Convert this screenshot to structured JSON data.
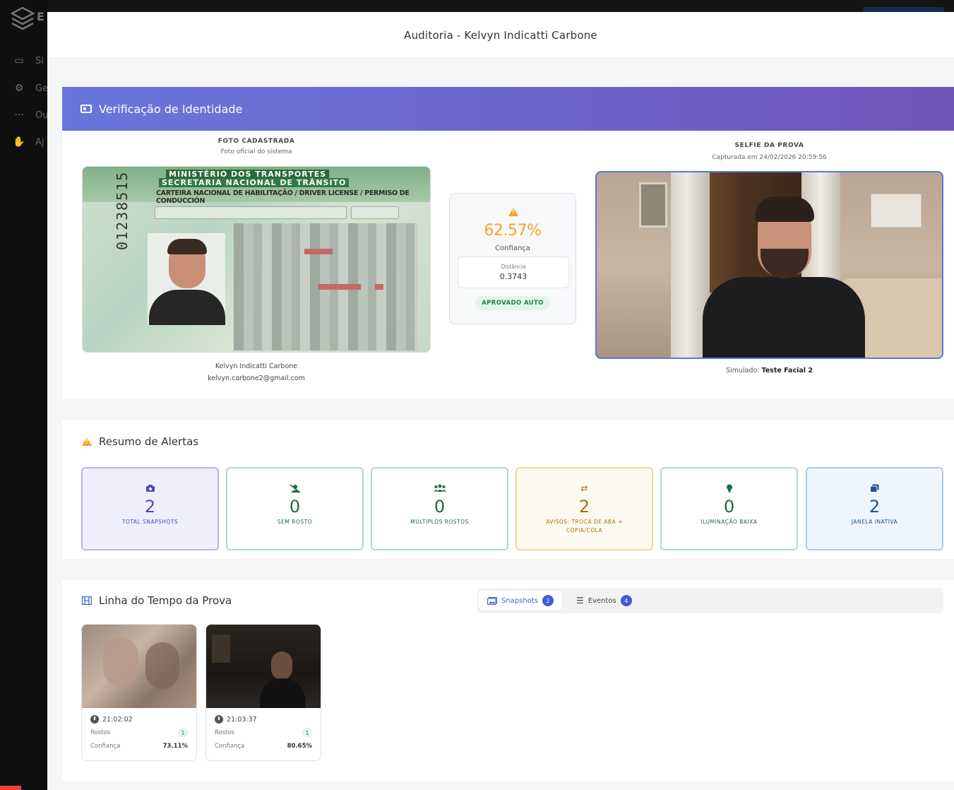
{
  "background": {
    "logo_text": "E",
    "nav": [
      {
        "label": "Si",
        "icon": "layout-icon"
      },
      {
        "label": "Ge",
        "icon": "gears-icon"
      },
      {
        "label": "Ou",
        "icon": "dots-icon"
      },
      {
        "label": "Aj",
        "icon": "handshake-icon"
      }
    ]
  },
  "modal": {
    "title": "Auditoria - Kelvyn Indicatti Carbone"
  },
  "identity": {
    "title": "Verificação de Identidade",
    "registered": {
      "label": "FOTO CADASTRADA",
      "sub": "Foto oficial do sistema",
      "license_line1": "MINISTÉRIO DOS TRANSPORTES",
      "license_line1b": "SECRETARIA NACIONAL DE TRÂNSITO",
      "license_line2": "CARTEIRA NACIONAL DE HABILITAÇÃO / DRIVER LICENSE / PERMISO DE CONDUCCIÓN",
      "license_number": "01238515",
      "name": "Kelvyn Indicatti Carbone",
      "email": "kelvyn.carbone2@gmail.com"
    },
    "confidence": {
      "value": "62.57%",
      "label": "Confiança",
      "distance_label": "Distância",
      "distance_value": "0.3743",
      "status": "APROVADO AUTO",
      "color": "#f5a623"
    },
    "selfie": {
      "label": "SELFIE DA PROVA",
      "sub": "Capturada em 24/02/2026 20:59:56",
      "simulado_label": "Simulado:",
      "simulado_value": "Teste Facial 2"
    }
  },
  "alerts": {
    "title": "Resumo de Alertas",
    "items": [
      {
        "icon": "camera-icon",
        "value": "2",
        "label": "TOTAL SNAPSHOTS",
        "color": "#4a49b8",
        "border": "#b9b6ec",
        "bg": "#efeefc"
      },
      {
        "icon": "user-slash-icon",
        "value": "0",
        "label": "SEM ROSTO",
        "color": "#1e6b3e",
        "border": "#a9dcbd",
        "bg": "#ffffff"
      },
      {
        "icon": "users-icon",
        "value": "0",
        "label": "MÚLTIPLOS ROSTOS",
        "color": "#1e6b3e",
        "border": "#a9dcbd",
        "bg": "#ffffff"
      },
      {
        "icon": "exchange-icon",
        "value": "2",
        "label": "AVISOS: TROCA DE ABA + CÓPIA/COLA",
        "color": "#a8700f",
        "border": "#f5d79a",
        "bg": "#fffaf0"
      },
      {
        "icon": "bulb-icon",
        "value": "0",
        "label": "ILUMINAÇÃO BAIXA",
        "color": "#1e6b3e",
        "border": "#a9dcbd",
        "bg": "#ffffff"
      },
      {
        "icon": "window-icon",
        "value": "2",
        "label": "JANELA INATIVA",
        "color": "#23508f",
        "border": "#a9c9ea",
        "bg": "#eef5fd"
      }
    ]
  },
  "timeline": {
    "title": "Linha do Tempo da Prova",
    "tabs": [
      {
        "label": "Snapshots",
        "count": "2"
      },
      {
        "label": "Eventos",
        "count": "4"
      }
    ],
    "snapshots": [
      {
        "time": "21:02:02",
        "faces_label": "Rostos",
        "faces": "1",
        "confidence_label": "Confiança",
        "confidence": "73.11%"
      },
      {
        "time": "21:03:37",
        "faces_label": "Rostos",
        "faces": "1",
        "confidence_label": "Confiança",
        "confidence": "80.65%"
      }
    ]
  }
}
